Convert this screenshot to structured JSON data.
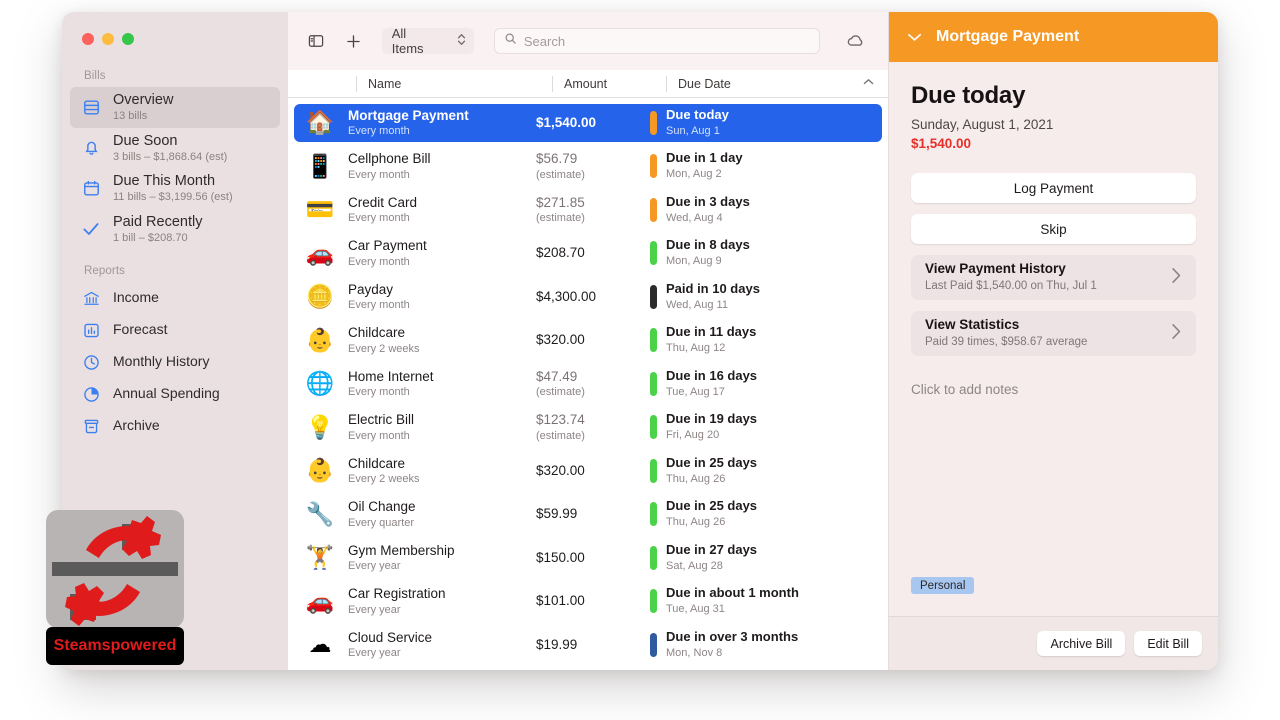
{
  "window": {
    "traffic_lights": [
      "close",
      "minimize",
      "zoom"
    ]
  },
  "sidebar": {
    "sections": [
      {
        "label": "Bills",
        "items": [
          {
            "icon": "list-icon",
            "title": "Overview",
            "sub": "13 bills",
            "selected": true
          },
          {
            "icon": "bell-icon",
            "title": "Due Soon",
            "sub": "3 bills – $1,868.64 (est)",
            "selected": false
          },
          {
            "icon": "calendar-icon",
            "title": "Due This Month",
            "sub": "11 bills – $3,199.56 (est)",
            "selected": false
          },
          {
            "icon": "checkmark-icon",
            "title": "Paid Recently",
            "sub": "1 bill – $208.70",
            "selected": false
          }
        ]
      },
      {
        "label": "Reports",
        "items": [
          {
            "icon": "bank-icon",
            "title": "Income",
            "sub": "",
            "selected": false
          },
          {
            "icon": "barchart-icon",
            "title": "Forecast",
            "sub": "",
            "selected": false
          },
          {
            "icon": "clock-icon",
            "title": "Monthly History",
            "sub": "",
            "selected": false
          },
          {
            "icon": "piechart-icon",
            "title": "Annual Spending",
            "sub": "",
            "selected": false
          },
          {
            "icon": "archive-icon",
            "title": "Archive",
            "sub": "",
            "selected": false
          }
        ]
      }
    ]
  },
  "toolbar": {
    "sidebar_toggle": "sidebar-toggle-icon",
    "add_label": "+",
    "filter_value": "All Items",
    "search_placeholder": "Search",
    "search_value": "",
    "cloud_icon": "cloud-icon"
  },
  "columns": {
    "name": "Name",
    "amount": "Amount",
    "due_date": "Due Date",
    "sort_direction": "ascending"
  },
  "rows": [
    {
      "emoji": "🏠",
      "name": "Mortgage Payment",
      "freq": "Every month",
      "amount": "$1,540.00",
      "estimate": "",
      "due": "Due today",
      "date": "Sun, Aug 1",
      "pill": "#f59824",
      "selected": true
    },
    {
      "emoji": "📱",
      "name": "Cellphone Bill",
      "freq": "Every month",
      "amount": "$56.79",
      "estimate": "(estimate)",
      "due": "Due in 1 day",
      "date": "Mon, Aug 2",
      "pill": "#f59824",
      "selected": false
    },
    {
      "emoji": "💳",
      "name": "Credit Card",
      "freq": "Every month",
      "amount": "$271.85",
      "estimate": "(estimate)",
      "due": "Due in 3 days",
      "date": "Wed, Aug 4",
      "pill": "#f59824",
      "selected": false
    },
    {
      "emoji": "🚗",
      "name": "Car Payment",
      "freq": "Every month",
      "amount": "$208.70",
      "estimate": "",
      "due": "Due in 8 days",
      "date": "Mon, Aug 9",
      "pill": "#4cd248",
      "selected": false
    },
    {
      "emoji": "🪙",
      "name": "Payday",
      "freq": "Every month",
      "amount": "$4,300.00",
      "estimate": "",
      "due": "Paid in 10 days",
      "date": "Wed, Aug 11",
      "pill": "#2b2b2b",
      "selected": false
    },
    {
      "emoji": "👶",
      "name": "Childcare",
      "freq": "Every 2 weeks",
      "amount": "$320.00",
      "estimate": "",
      "due": "Due in 11 days",
      "date": "Thu, Aug 12",
      "pill": "#4cd248",
      "selected": false
    },
    {
      "emoji": "🌐",
      "name": "Home Internet",
      "freq": "Every month",
      "amount": "$47.49",
      "estimate": "(estimate)",
      "due": "Due in 16 days",
      "date": "Tue, Aug 17",
      "pill": "#4cd248",
      "selected": false
    },
    {
      "emoji": "💡",
      "name": "Electric Bill",
      "freq": "Every month",
      "amount": "$123.74",
      "estimate": "(estimate)",
      "due": "Due in 19 days",
      "date": "Fri, Aug 20",
      "pill": "#4cd248",
      "selected": false
    },
    {
      "emoji": "👶",
      "name": "Childcare",
      "freq": "Every 2 weeks",
      "amount": "$320.00",
      "estimate": "",
      "due": "Due in 25 days",
      "date": "Thu, Aug 26",
      "pill": "#4cd248",
      "selected": false
    },
    {
      "emoji": "🔧",
      "name": "Oil Change",
      "freq": "Every quarter",
      "amount": "$59.99",
      "estimate": "",
      "due": "Due in 25 days",
      "date": "Thu, Aug 26",
      "pill": "#4cd248",
      "selected": false
    },
    {
      "emoji": "🏋",
      "name": "Gym Membership",
      "freq": "Every year",
      "amount": "$150.00",
      "estimate": "",
      "due": "Due in 27 days",
      "date": "Sat, Aug 28",
      "pill": "#4cd248",
      "selected": false
    },
    {
      "emoji": "🚗",
      "name": "Car Registration",
      "freq": "Every year",
      "amount": "$101.00",
      "estimate": "",
      "due": "Due in about 1 month",
      "date": "Tue, Aug 31",
      "pill": "#4cd248",
      "selected": false
    },
    {
      "emoji": "☁",
      "name": "Cloud Service",
      "freq": "Every year",
      "amount": "$19.99",
      "estimate": "",
      "due": "Due in over 3 months",
      "date": "Mon, Nov 8",
      "pill": "#2e5c9e",
      "selected": false
    }
  ],
  "detail": {
    "header_title": "Mortgage Payment",
    "header_color": "#f59824",
    "due_headline": "Due today",
    "due_date": "Sunday, August 1, 2021",
    "amount": "$1,540.00",
    "amount_color": "#e8302a",
    "log_payment_label": "Log Payment",
    "skip_label": "Skip",
    "cards": [
      {
        "title": "View Payment History",
        "sub": "Last Paid $1,540.00 on Thu, Jul 1"
      },
      {
        "title": "View Statistics",
        "sub": "Paid 39 times, $958.67 average"
      }
    ],
    "notes_placeholder": "Click to add notes",
    "tag": "Personal",
    "tag_color": "#a8c7f0",
    "archive_label": "Archive Bill",
    "edit_label": "Edit Bill"
  },
  "watermark": {
    "label": "Steamspowered"
  }
}
